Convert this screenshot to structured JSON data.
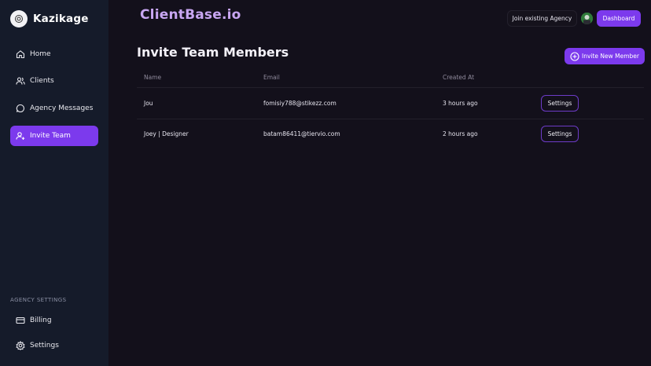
{
  "brand": {
    "name": "Kazikage"
  },
  "sidebar": {
    "items": [
      {
        "label": "Home",
        "icon": "home-icon"
      },
      {
        "label": "Clients",
        "icon": "users-icon"
      },
      {
        "label": "Agency Messages",
        "icon": "message-icon"
      },
      {
        "label": "Invite Team",
        "icon": "user-plus-icon",
        "active": true
      }
    ],
    "section_label": "AGENCY SETTINGS",
    "settings_items": [
      {
        "label": "Billing",
        "icon": "credit-card-icon"
      },
      {
        "label": "Settings",
        "icon": "gear-icon"
      }
    ]
  },
  "header": {
    "app_title": "ClientBase.io",
    "join_label": "Join existing Agency",
    "dashboard_label": "Dashboard"
  },
  "main": {
    "title": "Invite Team Members",
    "invite_label": "Invite New Member",
    "table": {
      "columns": [
        "Name",
        "Email",
        "Created At"
      ],
      "rows": [
        {
          "name": "Jou",
          "email": "fomisiy788@stikezz.com",
          "created": "3 hours ago",
          "action": "Settings"
        },
        {
          "name": "Joey | Designer",
          "email": "batam86411@tiervio.com",
          "created": "2 hours ago",
          "action": "Settings"
        }
      ]
    }
  },
  "colors": {
    "accent": "#7c3aed",
    "sidebar_bg": "#151b2a",
    "page_bg": "#13101b",
    "title_accent": "#c8a6f2"
  }
}
